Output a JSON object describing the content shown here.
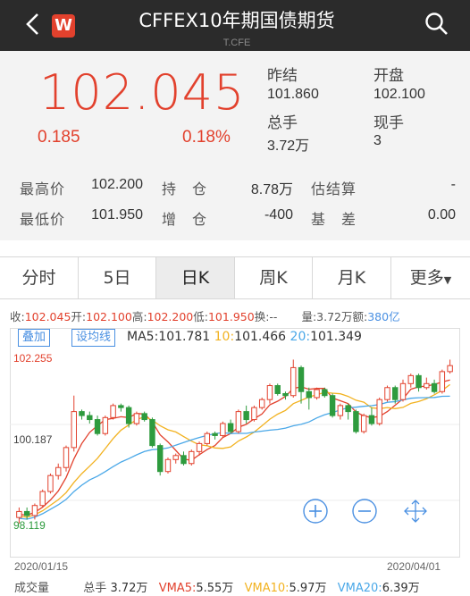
{
  "header": {
    "logo": "W",
    "title": "CFFEX10年期国债期货",
    "code": "T.CFE"
  },
  "quote": {
    "price": "102.045",
    "change": "0.185",
    "change_pct": "0.18%",
    "prev_close_label": "昨结",
    "prev_close": "101.860",
    "open_label": "开盘",
    "open": "102.100",
    "volume_label": "总手",
    "volume": "3.72万",
    "current_label": "现手",
    "current": "3",
    "rows": [
      {
        "l1": "最高价",
        "v1": "102.200",
        "l2": "持　仓",
        "v2": "8.78万",
        "l3": "估结算",
        "v3": "-"
      },
      {
        "l1": "最低价",
        "v1": "101.950",
        "l2": "增　仓",
        "v2": "-400",
        "l3": "基　差",
        "v3": "0.00"
      }
    ]
  },
  "tabs": [
    "分时",
    "5日",
    "日K",
    "周K",
    "月K",
    "更多"
  ],
  "info": {
    "close_label": "收:",
    "close": "102.045",
    "open_label": "开:",
    "open": "102.100",
    "high_label": "高:",
    "high": "102.200",
    "low_label": "低:",
    "low": "101.950",
    "turnover_label": "换:",
    "turnover": "--",
    "volume_label": "量:",
    "volume": "3.72万",
    "amount_label": "额:",
    "amount": "380亿"
  },
  "ma": {
    "btn_overlay": "叠加",
    "btn_ma": "设均线",
    "ma5_label": "MA5:",
    "ma5": "101.781",
    "ma10_label": "10:",
    "ma10": "101.466",
    "ma20_label": "20:",
    "ma20": "101.349"
  },
  "colors": {
    "up": "#e2412d",
    "down": "#2e9b3e",
    "ma5": "#e2412d",
    "ma10": "#f2b220",
    "ma20": "#4aa8e8",
    "accent": "#4a90e2"
  },
  "chart_data": {
    "type": "candlestick",
    "y_labels": [
      "102.255",
      "100.187",
      "98.119"
    ],
    "ylim": [
      98.119,
      102.255
    ],
    "start_date": "2020/01/15",
    "end_date": "2020/04/01",
    "candles": [
      [
        98.25,
        98.4,
        98.1,
        98.5
      ],
      [
        98.4,
        98.3,
        98.2,
        98.5
      ],
      [
        98.3,
        98.55,
        98.2,
        98.6
      ],
      [
        98.55,
        98.9,
        98.5,
        98.95
      ],
      [
        98.9,
        99.3,
        98.85,
        99.35
      ],
      [
        99.3,
        99.5,
        99.2,
        99.6
      ],
      [
        99.5,
        100.0,
        99.4,
        100.05
      ],
      [
        100.0,
        100.9,
        99.9,
        101.3
      ],
      [
        100.9,
        100.8,
        100.7,
        100.95
      ],
      [
        100.8,
        100.7,
        100.6,
        100.9
      ],
      [
        100.7,
        100.35,
        100.3,
        100.8
      ],
      [
        100.35,
        100.75,
        100.3,
        100.8
      ],
      [
        100.75,
        101.05,
        100.7,
        101.1
      ],
      [
        101.05,
        101.0,
        100.9,
        101.1
      ],
      [
        101.0,
        100.6,
        100.5,
        101.05
      ],
      [
        100.6,
        100.85,
        100.55,
        100.9
      ],
      [
        100.85,
        100.7,
        100.65,
        100.9
      ],
      [
        100.7,
        100.05,
        100.0,
        100.75
      ],
      [
        100.05,
        99.4,
        99.3,
        100.1
      ],
      [
        99.4,
        99.7,
        99.35,
        99.75
      ],
      [
        99.7,
        99.8,
        99.6,
        99.85
      ],
      [
        99.8,
        99.6,
        99.55,
        99.9
      ],
      [
        99.6,
        99.9,
        99.55,
        99.95
      ],
      [
        99.9,
        100.1,
        99.8,
        100.15
      ],
      [
        100.1,
        100.35,
        100.05,
        100.4
      ],
      [
        100.35,
        100.3,
        100.2,
        100.4
      ],
      [
        100.3,
        100.6,
        100.25,
        100.65
      ],
      [
        100.6,
        100.4,
        100.35,
        100.7
      ],
      [
        100.4,
        100.9,
        100.35,
        100.95
      ],
      [
        100.9,
        100.7,
        100.6,
        101.05
      ],
      [
        100.7,
        101.0,
        100.65,
        101.05
      ],
      [
        101.0,
        101.2,
        100.95,
        101.25
      ],
      [
        101.2,
        101.55,
        101.1,
        101.6
      ],
      [
        101.55,
        101.35,
        101.3,
        101.6
      ],
      [
        101.35,
        101.3,
        101.2,
        101.4
      ],
      [
        101.3,
        102.0,
        101.25,
        102.2
      ],
      [
        102.0,
        101.4,
        101.1,
        102.05
      ],
      [
        101.4,
        101.25,
        100.95,
        101.5
      ],
      [
        101.25,
        101.45,
        101.2,
        101.5
      ],
      [
        101.45,
        101.3,
        101.25,
        101.5
      ],
      [
        101.3,
        100.8,
        100.75,
        101.35
      ],
      [
        100.8,
        101.05,
        100.7,
        101.1
      ],
      [
        101.05,
        100.9,
        100.7,
        101.1
      ],
      [
        100.9,
        100.4,
        100.35,
        100.95
      ],
      [
        100.4,
        100.8,
        100.35,
        100.85
      ],
      [
        100.8,
        100.6,
        100.55,
        101.0
      ],
      [
        100.6,
        101.2,
        100.55,
        101.25
      ],
      [
        101.2,
        101.5,
        101.15,
        101.55
      ],
      [
        101.5,
        101.2,
        101.1,
        101.55
      ],
      [
        101.2,
        101.6,
        101.15,
        101.7
      ],
      [
        101.6,
        101.8,
        101.5,
        101.85
      ],
      [
        101.8,
        101.5,
        101.4,
        101.85
      ],
      [
        101.5,
        101.6,
        101.45,
        101.75
      ],
      [
        101.6,
        101.4,
        101.35,
        101.7
      ],
      [
        101.4,
        101.9,
        101.35,
        101.95
      ],
      [
        101.9,
        102.05,
        101.85,
        102.2
      ]
    ]
  },
  "dates": {
    "start": "2020/01/15",
    "end": "2020/04/01"
  },
  "volume_row": {
    "label": "成交量",
    "total_label": "总手",
    "total": "3.72万",
    "vma5_label": "VMA5:",
    "vma5": "5.55万",
    "vma10_label": "VMA10:",
    "vma10": "5.97万",
    "vma20_label": "VMA20:",
    "vma20": "6.39万"
  }
}
